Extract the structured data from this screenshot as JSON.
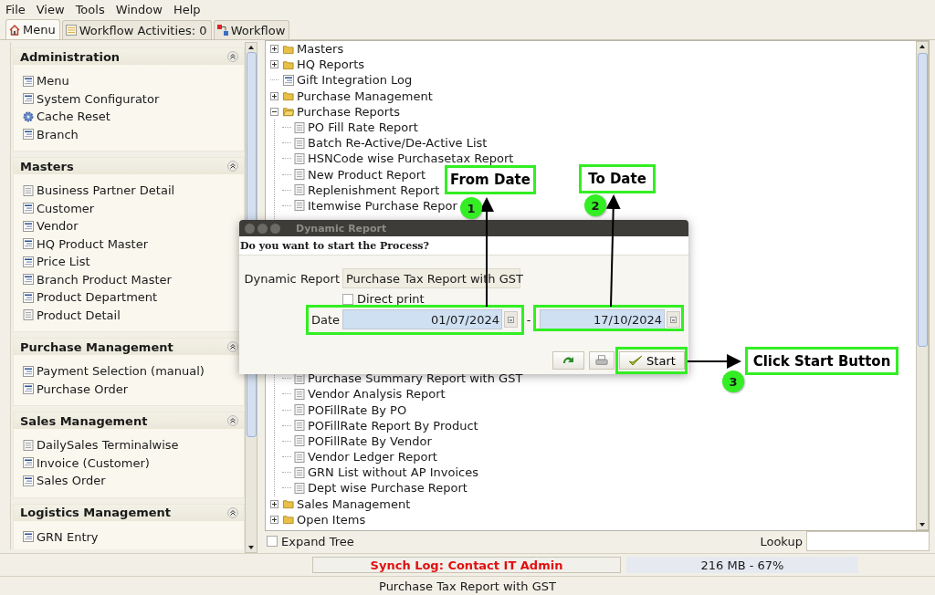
{
  "menu_bar": [
    "File",
    "View",
    "Tools",
    "Window",
    "Help"
  ],
  "tabs": [
    {
      "label": "Menu",
      "kind": "home",
      "selected": true
    },
    {
      "label": "Workflow Activities: 0",
      "kind": "list",
      "selected": false
    },
    {
      "label": "Workflow",
      "kind": "flow",
      "selected": false
    }
  ],
  "sidebar": {
    "sections": [
      {
        "title": "Administration",
        "items": [
          {
            "label": "Menu",
            "kind": "window"
          },
          {
            "label": "System Configurator",
            "kind": "window"
          },
          {
            "label": "Cache Reset",
            "kind": "process"
          },
          {
            "label": "Branch",
            "kind": "window"
          }
        ]
      },
      {
        "title": "Masters",
        "items": [
          {
            "label": "Business Partner Detail",
            "kind": "report"
          },
          {
            "label": "Customer",
            "kind": "window"
          },
          {
            "label": "Vendor",
            "kind": "window"
          },
          {
            "label": "HQ Product Master",
            "kind": "window"
          },
          {
            "label": "Price List",
            "kind": "window"
          },
          {
            "label": "Branch Product Master",
            "kind": "window"
          },
          {
            "label": "Product Department",
            "kind": "window"
          },
          {
            "label": "Product Detail",
            "kind": "report"
          }
        ]
      },
      {
        "title": "Purchase Management",
        "items": [
          {
            "label": "Payment Selection (manual)",
            "kind": "window"
          },
          {
            "label": "Purchase Order",
            "kind": "window"
          }
        ]
      },
      {
        "title": "Sales Management",
        "items": [
          {
            "label": "DailySales Terminalwise",
            "kind": "report"
          },
          {
            "label": "Invoice (Customer)",
            "kind": "window"
          },
          {
            "label": "Sales Order",
            "kind": "window"
          }
        ]
      },
      {
        "title": "Logistics Management",
        "items": [
          {
            "label": "GRN Entry",
            "kind": "window"
          }
        ]
      }
    ]
  },
  "tree": {
    "items": [
      {
        "label": "Masters",
        "kind": "folder",
        "expanded": false
      },
      {
        "label": "HQ Reports",
        "kind": "folder",
        "expanded": false
      },
      {
        "label": "Gift Integration Log",
        "kind": "window"
      },
      {
        "label": "Purchase Management",
        "kind": "folder",
        "expanded": false
      },
      {
        "label": "Purchase Reports",
        "kind": "folder",
        "expanded": true,
        "children": [
          {
            "label": "PO Fill Rate Report",
            "kind": "report"
          },
          {
            "label": "Batch Re-Active/De-Active List",
            "kind": "report"
          },
          {
            "label": "HSNCode wise Purchasetax Report",
            "kind": "report"
          },
          {
            "label": "New Product Report",
            "kind": "report"
          },
          {
            "label": "Replenishment Report",
            "kind": "report"
          },
          {
            "label": "Itemwise Purchase Repor",
            "kind": "report"
          },
          {
            "label": "Purchase Summary Report with GST",
            "kind": "report"
          },
          {
            "label": "Vendor Analysis Report",
            "kind": "report"
          },
          {
            "label": "POFillRate By PO",
            "kind": "report"
          },
          {
            "label": "POFillRate Report By Product",
            "kind": "report"
          },
          {
            "label": "POFillRate By Vendor",
            "kind": "report"
          },
          {
            "label": "Vendor Ledger Report",
            "kind": "report"
          },
          {
            "label": "GRN List without AP Invoices",
            "kind": "report"
          },
          {
            "label": "Dept wise Purchase Report",
            "kind": "report"
          }
        ]
      },
      {
        "label": "Sales Management",
        "kind": "folder",
        "expanded": false
      },
      {
        "label": "Open Items",
        "kind": "folder",
        "expanded": false
      }
    ]
  },
  "tree_footer": {
    "expand_tree": {
      "label": "Expand Tree",
      "checked": false
    },
    "lookup_label": "Lookup"
  },
  "dialog": {
    "title": "Dynamic Report",
    "message": "Do you want to start the Process?",
    "report_label": "Dynamic Report",
    "report_value": "Purchase Tax Report with GST",
    "direct_print": {
      "label": "Direct print",
      "checked": false
    },
    "date_label": "Date",
    "date_from": "01/07/2024",
    "separator": "-",
    "date_to": "17/10/2024",
    "start_label": "Start"
  },
  "annotations": [
    {
      "number": "1",
      "label": "From Date"
    },
    {
      "number": "2",
      "label": "To Date"
    },
    {
      "number": "3",
      "label": "Click Start Button"
    }
  ],
  "status_bar": {
    "synch_log": "Synch Log: Contact IT Admin",
    "memory": "216 MB - 67%",
    "current": "Purchase Tax Report with GST"
  }
}
